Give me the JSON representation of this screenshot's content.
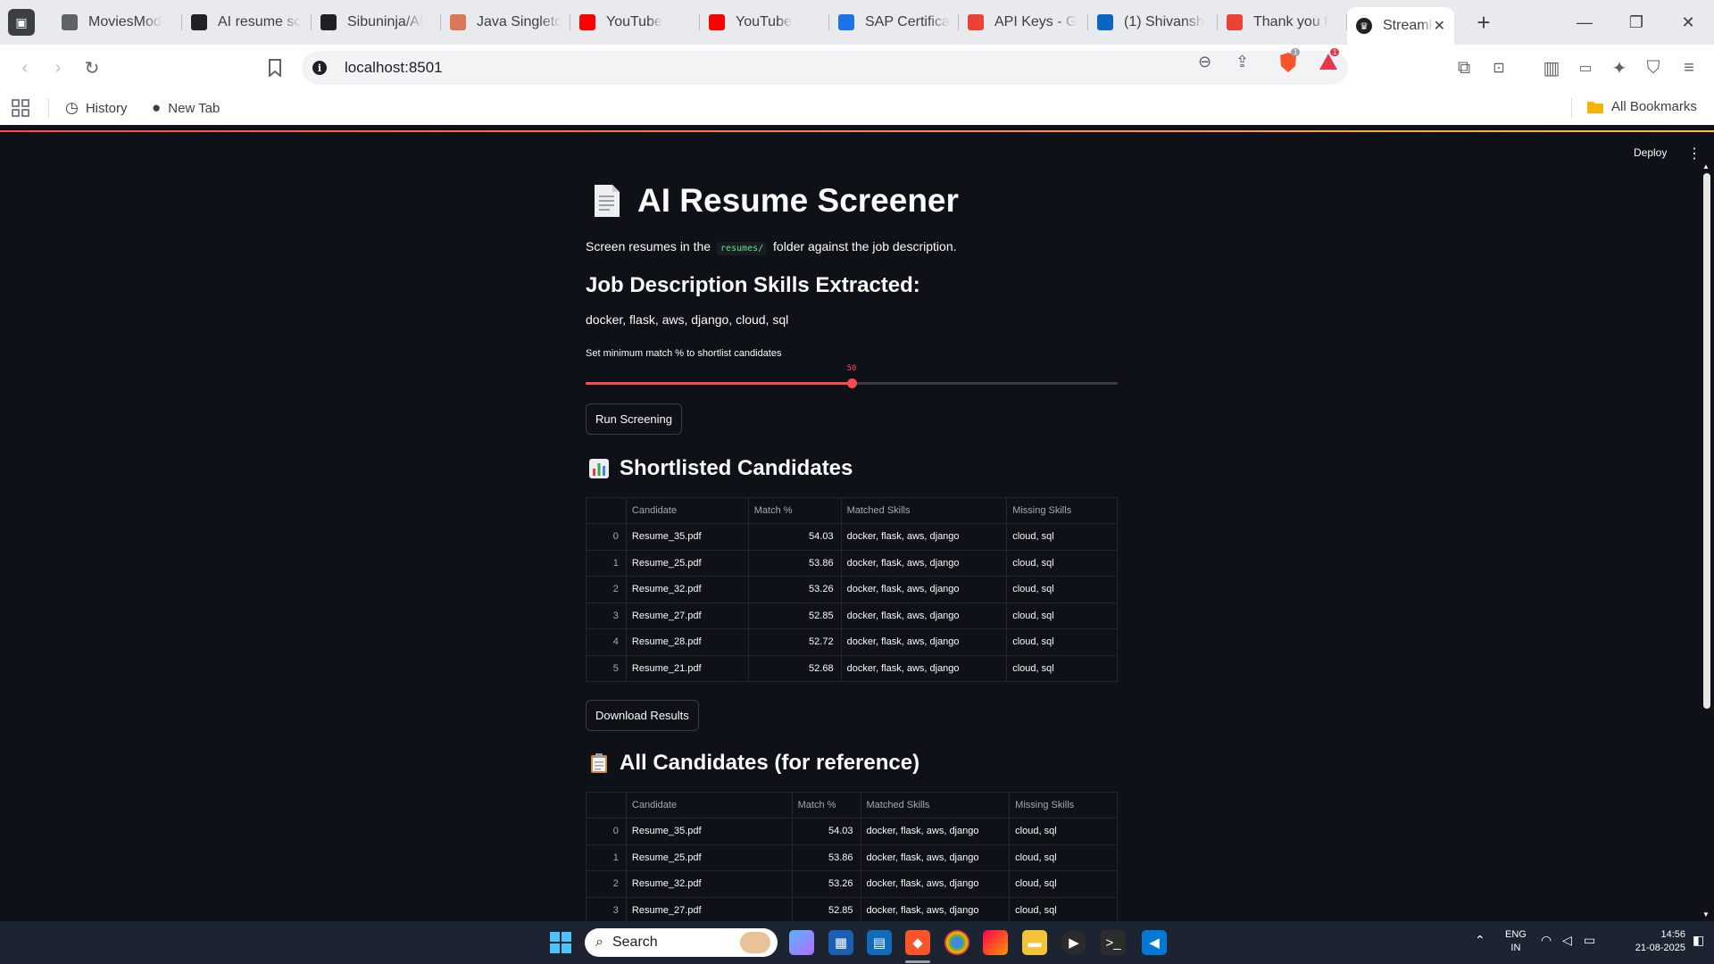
{
  "browser": {
    "tabs": [
      {
        "title": "MoviesMod",
        "icon": "globe-icon",
        "color": "#5f6368"
      },
      {
        "title": "AI resume sc",
        "icon": "openai-icon",
        "color": "#202124"
      },
      {
        "title": "Sibuninja/AI",
        "icon": "github-icon",
        "color": "#202124"
      },
      {
        "title": "Java Singleto",
        "icon": "claude-icon",
        "color": "#d97757"
      },
      {
        "title": "YouTube",
        "icon": "youtube-icon",
        "color": "#ff0000"
      },
      {
        "title": "YouTube",
        "icon": "youtube-icon",
        "color": "#ff0000"
      },
      {
        "title": "SAP Certifica",
        "icon": "sap-icon",
        "color": "#1a73e8"
      },
      {
        "title": "API Keys - G",
        "icon": "api-icon",
        "color": "#ea4335"
      },
      {
        "title": "(1) Shivansh",
        "icon": "linkedin-icon",
        "color": "#0a66c2"
      },
      {
        "title": "Thank you f",
        "icon": "gmail-icon",
        "color": "#ea4335"
      }
    ],
    "active_tab": {
      "title": "Streamli",
      "close": "✕"
    },
    "new_tab": "+",
    "address": "localhost:8501",
    "shield_badge": "1",
    "rewards_badge": "1",
    "bookmarks": {
      "history": "History",
      "new_tab": "New Tab",
      "all_bookmarks": "All Bookmarks"
    }
  },
  "app": {
    "deploy": "Deploy",
    "title": "AI Resume Screener",
    "caption_before": "Screen resumes in the",
    "caption_code": "resumes/",
    "caption_after": "folder against the job description.",
    "skills_heading": "Job Description Skills Extracted:",
    "skills": "docker, flask, aws, django, cloud, sql",
    "slider_label": "Set minimum match % to shortlist candidates",
    "slider_value": 50,
    "slider_value_text": "50",
    "slider_max": 100,
    "run_button": "Run Screening",
    "shortlisted_heading": "Shortlisted Candidates",
    "download_button": "Download Results",
    "all_heading": "All Candidates (for reference)",
    "columns": [
      "",
      "Candidate",
      "Match %",
      "Matched Skills",
      "Missing Skills"
    ],
    "shortlisted_rows": [
      [
        "0",
        "Resume_35.pdf",
        "54.03",
        "docker, flask, aws, django",
        "cloud, sql"
      ],
      [
        "1",
        "Resume_25.pdf",
        "53.86",
        "docker, flask, aws, django",
        "cloud, sql"
      ],
      [
        "2",
        "Resume_32.pdf",
        "53.26",
        "docker, flask, aws, django",
        "cloud, sql"
      ],
      [
        "3",
        "Resume_27.pdf",
        "52.85",
        "docker, flask, aws, django",
        "cloud, sql"
      ],
      [
        "4",
        "Resume_28.pdf",
        "52.72",
        "docker, flask, aws, django",
        "cloud, sql"
      ],
      [
        "5",
        "Resume_21.pdf",
        "52.68",
        "docker, flask, aws, django",
        "cloud, sql"
      ]
    ],
    "all_rows": [
      [
        "0",
        "Resume_35.pdf",
        "54.03",
        "docker, flask, aws, django",
        "cloud, sql"
      ],
      [
        "1",
        "Resume_25.pdf",
        "53.86",
        "docker, flask, aws, django",
        "cloud, sql"
      ],
      [
        "2",
        "Resume_32.pdf",
        "53.26",
        "docker, flask, aws, django",
        "cloud, sql"
      ],
      [
        "3",
        "Resume_27.pdf",
        "52.85",
        "docker, flask, aws, django",
        "cloud, sql"
      ]
    ],
    "accent": "#ff4b4b"
  },
  "taskbar": {
    "search": "Search",
    "lang_1": "ENG",
    "lang_2": "IN",
    "time": "14:56",
    "date": "21-08-2025"
  }
}
